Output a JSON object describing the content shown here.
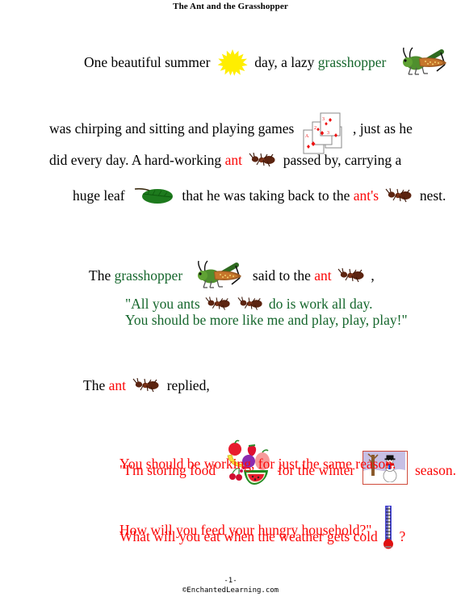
{
  "document": {
    "title": "The Ant and the Grasshopper",
    "type": "story-worksheet",
    "colors": {
      "text": "#000000",
      "grasshopper_green": "#15662c",
      "ant_red": "#fb0707",
      "sun_yellow": "#ffee00",
      "leaf_green": "#1d7a1d",
      "winter_sky": "#c6bfe4",
      "thermometer_blue": "#2222cc",
      "thermometer_bulb": "#e01111"
    }
  },
  "story": {
    "paragraph1": {
      "line1": {
        "a": "One beautiful summer",
        "icon1": "sun-icon",
        "b": "day, a lazy",
        "highlight": "grasshopper",
        "icon2": "grasshopper-icon"
      },
      "line2": {
        "a": "was chirping and sitting and playing games",
        "icon1": "playing-cards-icon",
        "b": ", just as he"
      },
      "line3": {
        "a": "did every day.  A hard-working",
        "highlight": "ant",
        "icon1": "ant-icon",
        "b": "passed by, carrying a"
      },
      "line4": {
        "a": "huge leaf",
        "icon1": "leaf-icon",
        "b": "that he was taking back to the",
        "highlight": "ant's",
        "icon2": "ant-icon",
        "c": "nest."
      }
    },
    "paragraph2": {
      "line1": {
        "a": "The",
        "highlight1": "grasshopper",
        "icon1": "grasshopper-icon",
        "b": "said to the",
        "highlight2": "ant",
        "icon2": "ant-icon",
        "c": ","
      }
    },
    "quote_grasshopper": {
      "line1": {
        "a": "\"All you ants",
        "icon1": "ant-icon",
        "icon2": "ant-icon",
        "b": "do is work all day."
      },
      "line2": "You should be more like me and play, play, play!\""
    },
    "paragraph3": {
      "line1": {
        "a": "The",
        "highlight": "ant",
        "icon1": "ant-icon",
        "b": "replied,"
      }
    },
    "quote_ant": {
      "line1": {
        "a": "\"I'm storing food",
        "icon1": "fruit-basket-icon",
        "b": "for the winter",
        "icon2": "winter-scene-icon",
        "c": "season."
      },
      "line2": "You should be working, for just the same reason.",
      "line3": {
        "a": "What will you eat when the weather gets cold",
        "icon1": "thermometer-icon",
        "b": "?"
      },
      "line4": "How will you feed your hungry household?\""
    }
  },
  "footer": {
    "page_number": "-1-",
    "copyright": "©EnchantedLearning.com"
  }
}
